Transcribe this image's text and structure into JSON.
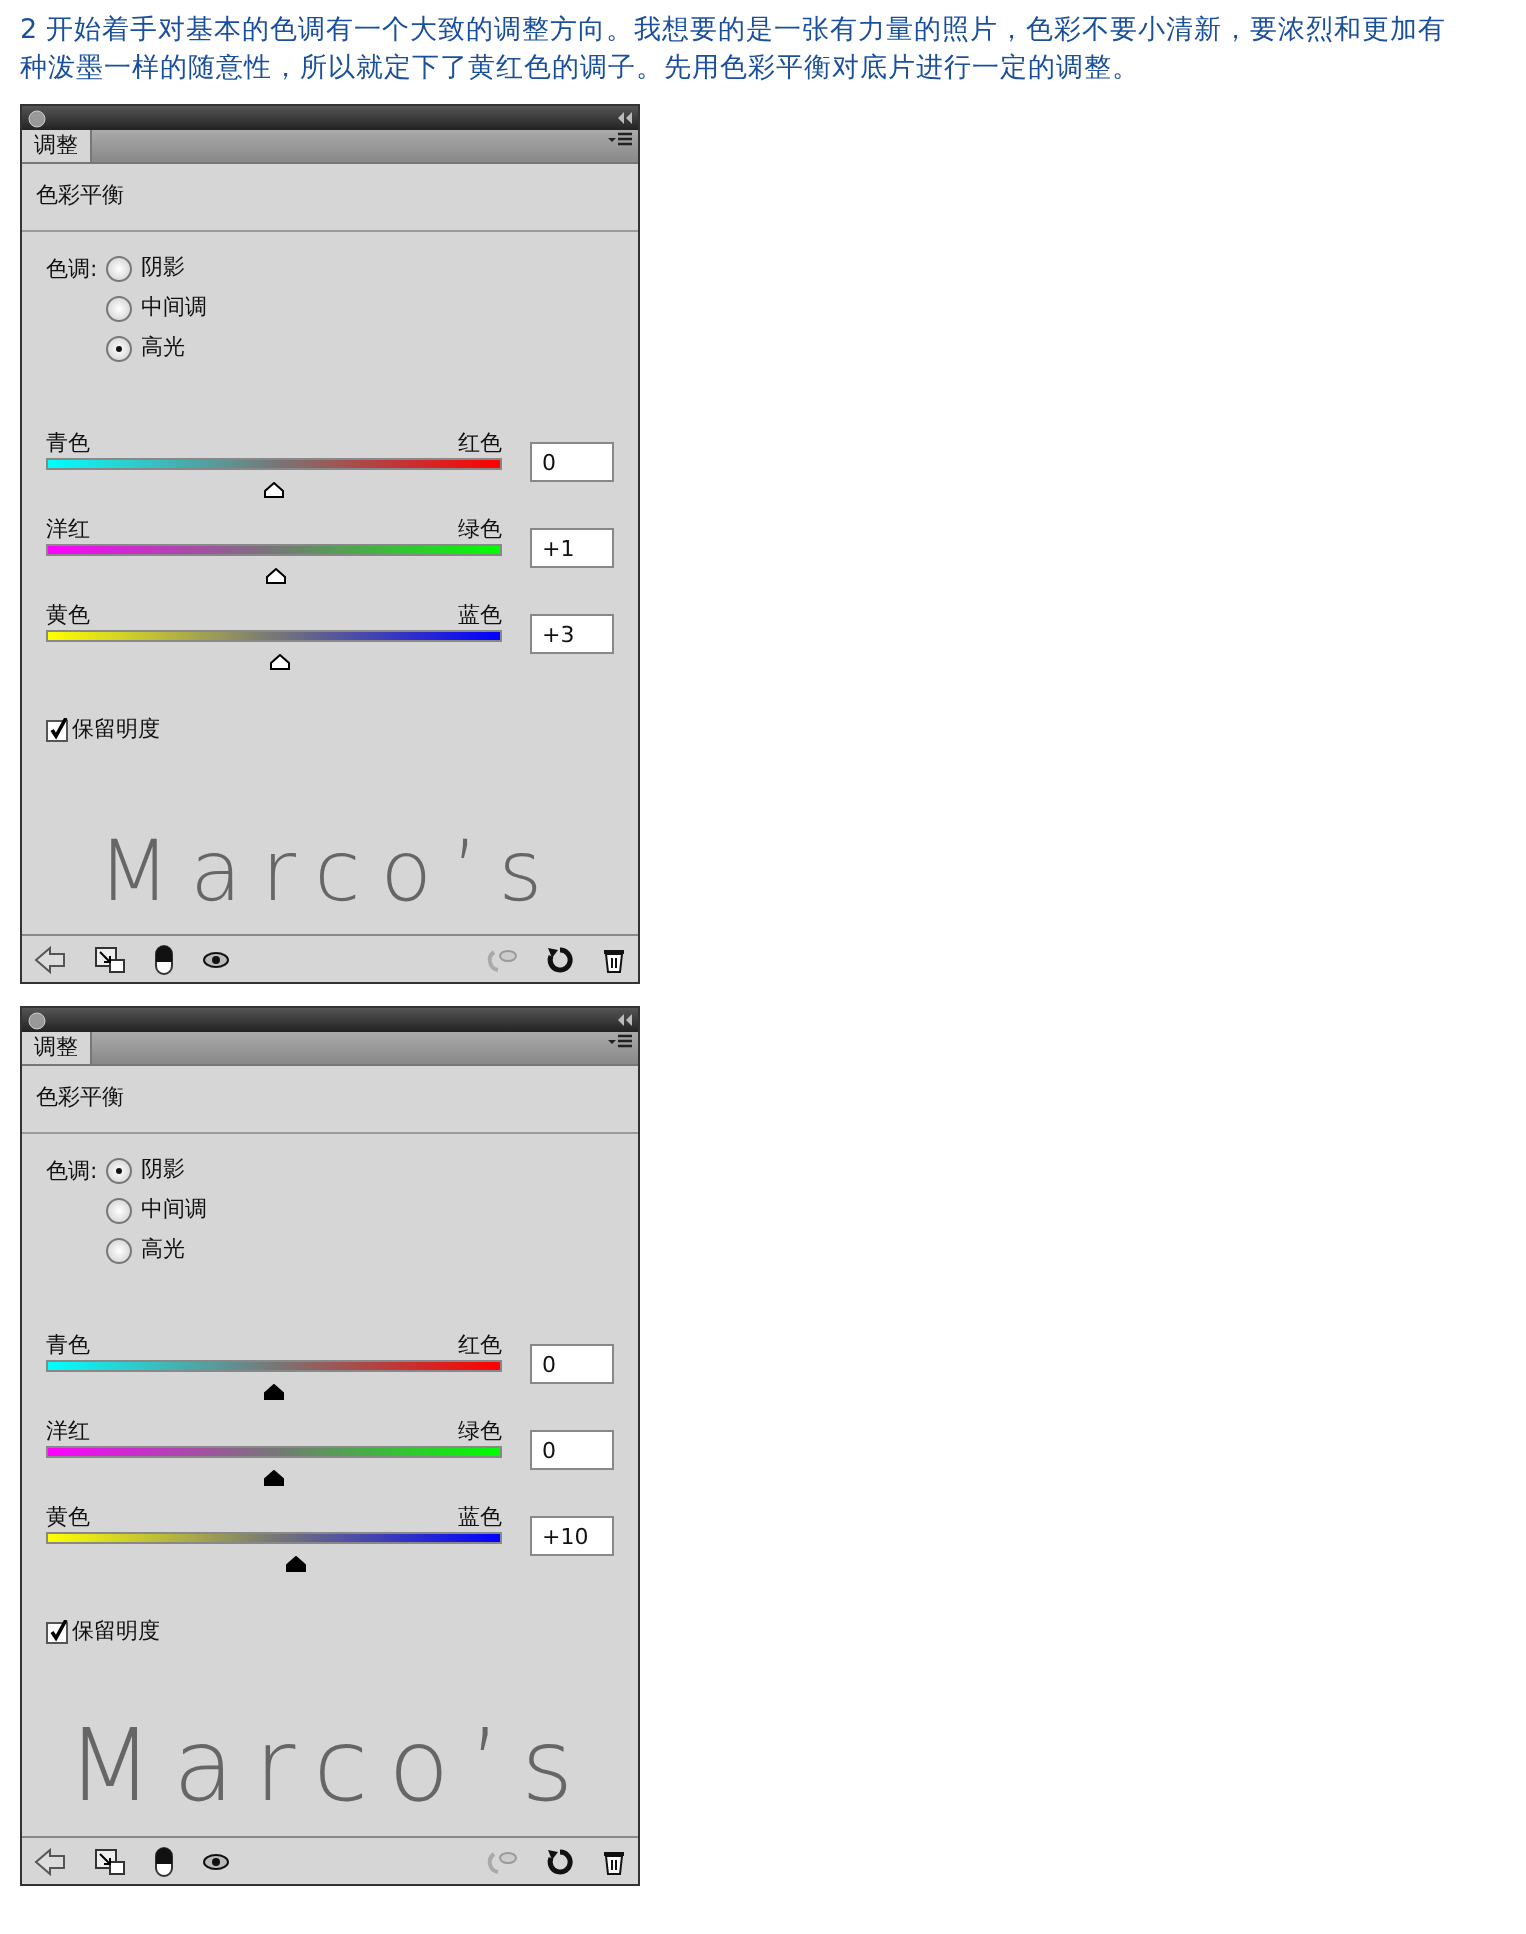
{
  "intro": "2 开始着手对基本的色调有一个大致的调整方向。我想要的是一张有力量的照片，色彩不要小清新，要浓烈和更加有种泼墨一样的随意性，所以就定下了黄红色的调子。先用色彩平衡对底片进行一定的调整。",
  "panels": [
    {
      "tab": {
        "label": "调整",
        "selected": true
      },
      "heading": "色彩平衡",
      "tone_label": "色调:",
      "kind": "hollow",
      "tones": [
        {
          "label": "阴影",
          "selected": false
        },
        {
          "label": "中间调",
          "selected": false
        },
        {
          "label": "高光",
          "selected": true
        }
      ],
      "sliders": [
        {
          "left": "青色",
          "right": "红色",
          "kind": "cyan-red",
          "level": 0.5,
          "value": "0"
        },
        {
          "left": "洋红",
          "right": "绿色",
          "kind": "magenta-green",
          "level": 0.505,
          "value": "+1"
        },
        {
          "left": "黄色",
          "right": "蓝色",
          "kind": "yellow-blue",
          "level": 0.515,
          "value": "+3"
        }
      ],
      "preserve": {
        "label": "保留明度",
        "checked": true
      },
      "signature": "Marco’s"
    },
    {
      "tab": {
        "label": "调整",
        "selected": true
      },
      "heading": "色彩平衡",
      "tone_label": "色调:",
      "kind": "filled",
      "tones": [
        {
          "label": "阴影",
          "selected": true
        },
        {
          "label": "中间调",
          "selected": false
        },
        {
          "label": "高光",
          "selected": false
        }
      ],
      "sliders": [
        {
          "left": "青色",
          "right": "红色",
          "kind": "cyan-red",
          "level": 0.5,
          "value": "0"
        },
        {
          "left": "洋红",
          "right": "绿色",
          "kind": "magenta-green",
          "level": 0.5,
          "value": "0"
        },
        {
          "left": "黄色",
          "right": "蓝色",
          "kind": "yellow-blue",
          "level": 0.55,
          "value": "+10"
        }
      ],
      "preserve": {
        "label": "保留明度",
        "checked": true
      },
      "signature": "Marco’s"
    }
  ]
}
